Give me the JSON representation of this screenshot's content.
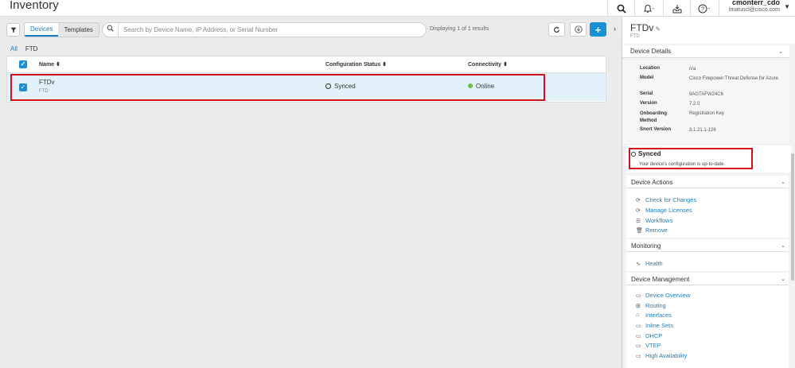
{
  "header": {
    "title": "Inventory",
    "user_name": "cmonterr_cdo",
    "user_email": "lmatuscl@cisco.com"
  },
  "toolbar": {
    "seg_devices": "Devices",
    "seg_templates": "Templates",
    "search_placeholder": "Search by Device Name, IP Address, or Serial Number",
    "results_text": "Displaying 1 of 1 results"
  },
  "tabs": [
    "All",
    "FTD"
  ],
  "table": {
    "columns": [
      "Name",
      "Configuration Status",
      "Connectivity"
    ],
    "rows": [
      {
        "name": "FTDv",
        "type": "FTD",
        "status": "Synced",
        "connectivity": "Online"
      }
    ]
  },
  "panel": {
    "title": "FTDv",
    "subtitle": "FTD",
    "details_header": "Device Details",
    "details": [
      {
        "label": "Location",
        "value": "n/a"
      },
      {
        "label": "Model",
        "value": "Cisco Firepower Threat Defense for Azure"
      },
      {
        "label": "Serial",
        "value": "9AGTAFW24C6"
      },
      {
        "label": "Version",
        "value": "7.2.0"
      },
      {
        "label": "Onboarding Method",
        "value": "Registration Key"
      },
      {
        "label": "Snort Version",
        "value": "3.1.21.1-126"
      }
    ],
    "sync_title": "Synced",
    "sync_message": "Your device's configuration is up-to-date.",
    "actions_header": "Device Actions",
    "actions": [
      "Check for Changes",
      "Manage Licenses",
      "Workflows",
      "Remove"
    ],
    "monitoring_header": "Monitoring",
    "monitoring": [
      "Health"
    ],
    "management_header": "Device Management",
    "management": [
      "Device Overview",
      "Routing",
      "Interfaces",
      "Inline Sets",
      "DHCP",
      "VTEP",
      "High Availability"
    ]
  },
  "colors": {
    "accent": "#1a7ec2",
    "online": "#6abf40",
    "highlight": "#d0101b"
  }
}
